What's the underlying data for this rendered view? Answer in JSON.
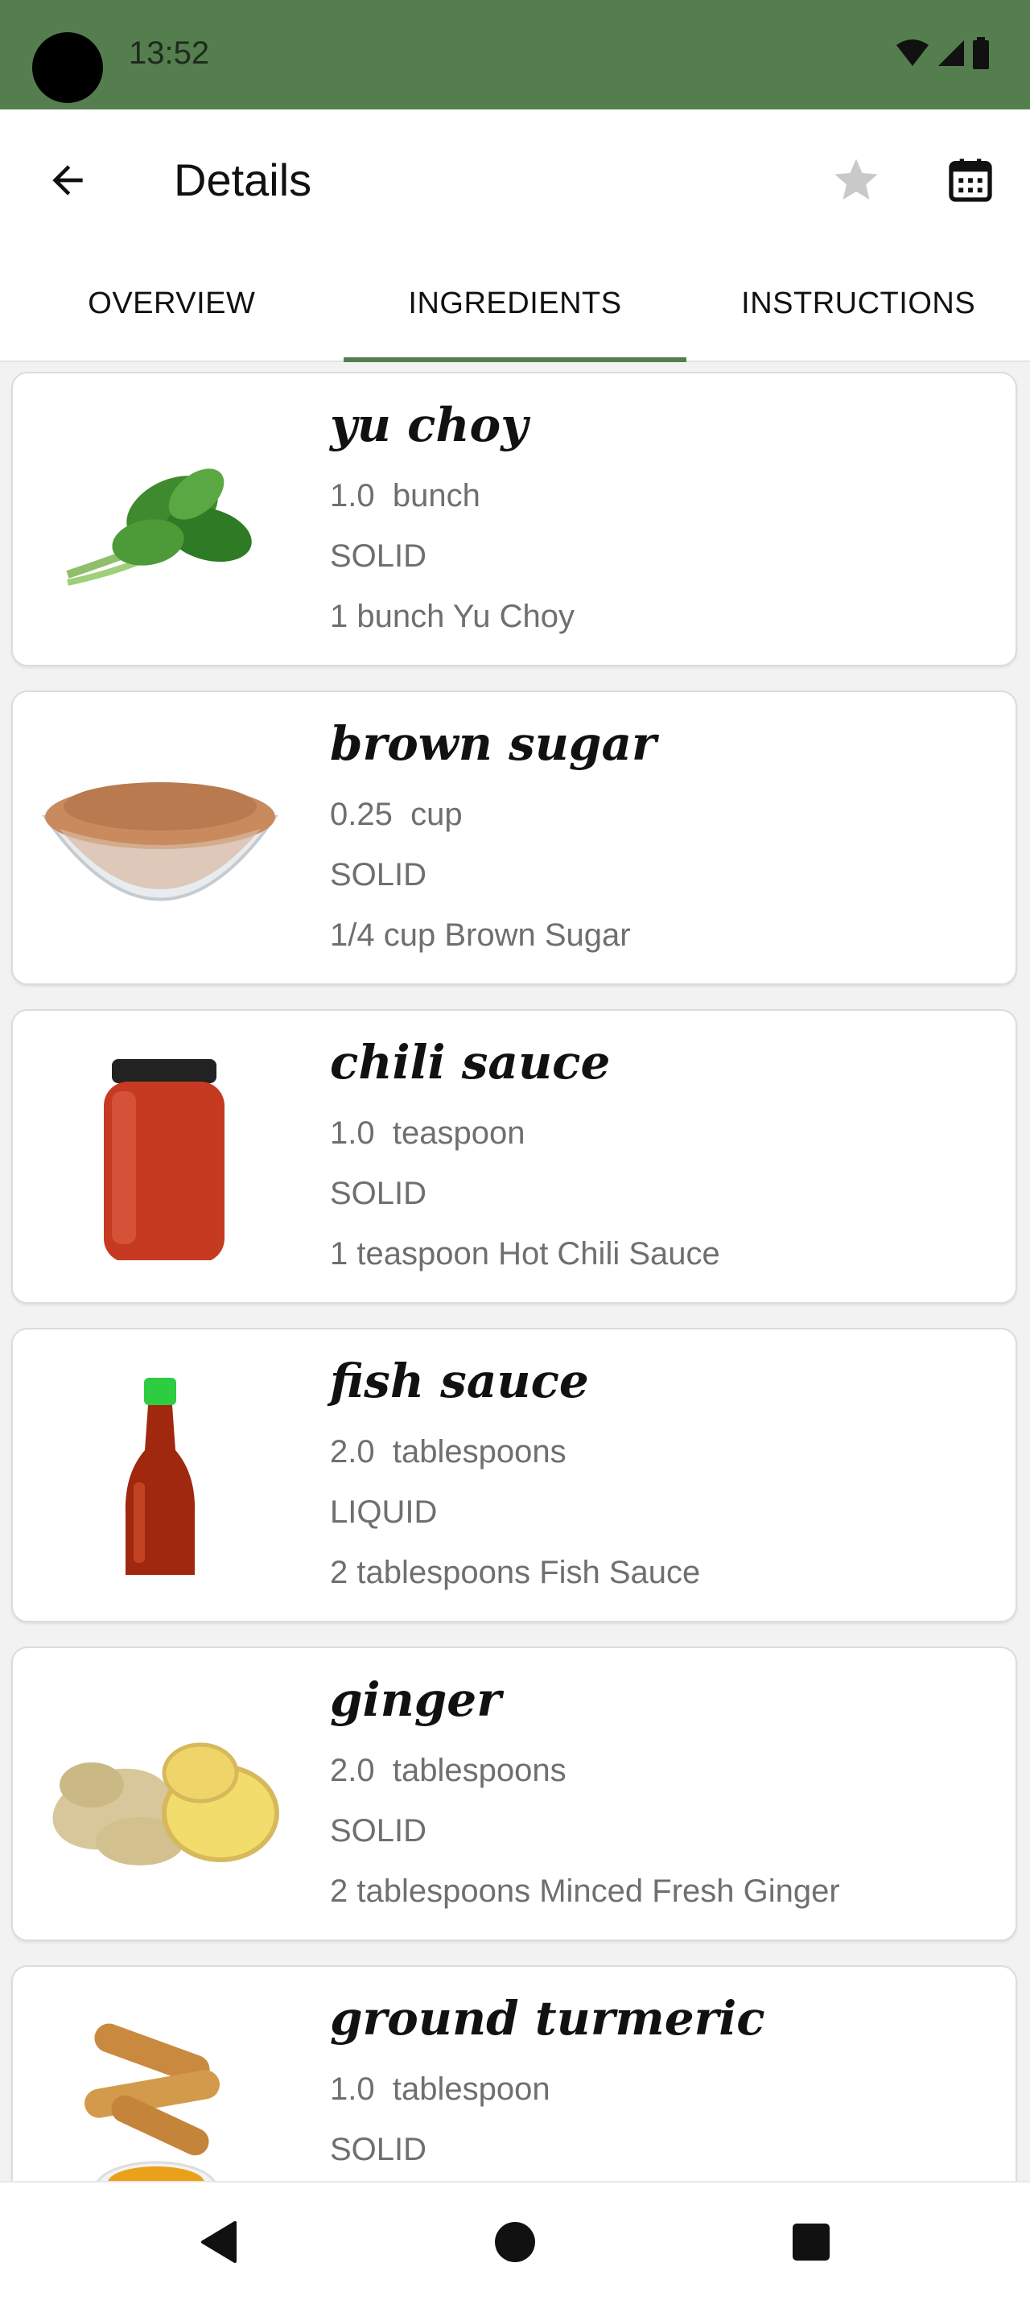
{
  "status_bar": {
    "time": "13:52"
  },
  "app_bar": {
    "title": "Details"
  },
  "tabs": [
    {
      "label": "OVERVIEW",
      "active": false
    },
    {
      "label": "INGREDIENTS",
      "active": true
    },
    {
      "label": "INSTRUCTIONS",
      "active": false
    }
  ],
  "ingredients": [
    {
      "name": "yu choy",
      "amount": "1.0",
      "unit": "bunch",
      "type": "SOLID",
      "original": "1 bunch Yu Choy",
      "image_icon": "yu-choy-image"
    },
    {
      "name": "brown sugar",
      "amount": "0.25",
      "unit": "cup",
      "type": "SOLID",
      "original": "1/4 cup Brown Sugar",
      "image_icon": "brown-sugar-image"
    },
    {
      "name": "chili sauce",
      "amount": "1.0",
      "unit": "teaspoon",
      "type": "SOLID",
      "original": "1 teaspoon Hot Chili Sauce",
      "image_icon": "chili-sauce-image"
    },
    {
      "name": "fish sauce",
      "amount": "2.0",
      "unit": "tablespoons",
      "type": "LIQUID",
      "original": "2 tablespoons Fish Sauce",
      "image_icon": "fish-sauce-image"
    },
    {
      "name": "ginger",
      "amount": "2.0",
      "unit": "tablespoons",
      "type": "SOLID",
      "original": "2 tablespoons Minced Fresh Ginger",
      "image_icon": "ginger-image"
    },
    {
      "name": "ground turmeric",
      "amount": "1.0",
      "unit": "tablespoon",
      "type": "SOLID",
      "original": "",
      "image_icon": "turmeric-image"
    }
  ],
  "colors": {
    "status_bar": "#557e4f",
    "tab_indicator": "#557e4f",
    "secondary_text": "#6f6f6f",
    "star_inactive": "#c9c9c9"
  },
  "icons": {
    "back": "arrow-left-icon",
    "favorite": "star-icon",
    "calendar": "calendar-icon",
    "nav_back": "triangle-back-icon",
    "nav_home": "circle-home-icon",
    "nav_recents": "square-recents-icon"
  }
}
